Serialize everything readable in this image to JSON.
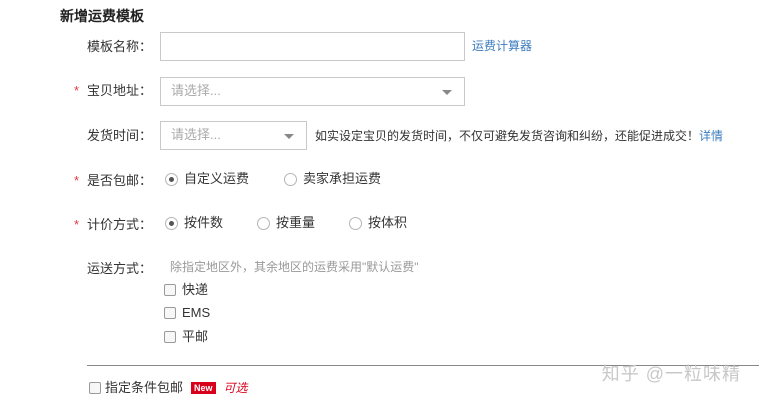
{
  "form": {
    "title": "新增运费模板",
    "template_name": {
      "label": "模板名称：",
      "value": "",
      "link": "运费计算器"
    },
    "location": {
      "required_mark": "*",
      "label": "宝贝地址：",
      "placeholder": "请选择..."
    },
    "ship_time": {
      "label": "发货时间：",
      "placeholder": "请选择...",
      "hint": "如实设定宝贝的发货时间，不仅可避免发货咨询和纠纷，还能促进成交！",
      "hint_link": "详情"
    },
    "free_shipping": {
      "required_mark": "*",
      "label": "是否包邮：",
      "options": [
        {
          "label": "自定义运费",
          "checked": true
        },
        {
          "label": "卖家承担运费",
          "checked": false
        }
      ]
    },
    "pricing": {
      "required_mark": "*",
      "label": "计价方式：",
      "options": [
        {
          "label": "按件数",
          "checked": true
        },
        {
          "label": "按重量",
          "checked": false
        },
        {
          "label": "按体积",
          "checked": false
        }
      ]
    },
    "delivery": {
      "label": "运送方式：",
      "hint": "除指定地区外，其余地区的运费采用\"默认运费\"",
      "options": [
        {
          "label": "快递",
          "checked": false
        },
        {
          "label": "EMS",
          "checked": false
        },
        {
          "label": "平邮",
          "checked": false
        }
      ]
    },
    "conditional_free": {
      "label": "指定条件包邮",
      "badge": "New",
      "optional": "可选"
    }
  },
  "watermark": "知乎 @一粒味精"
}
